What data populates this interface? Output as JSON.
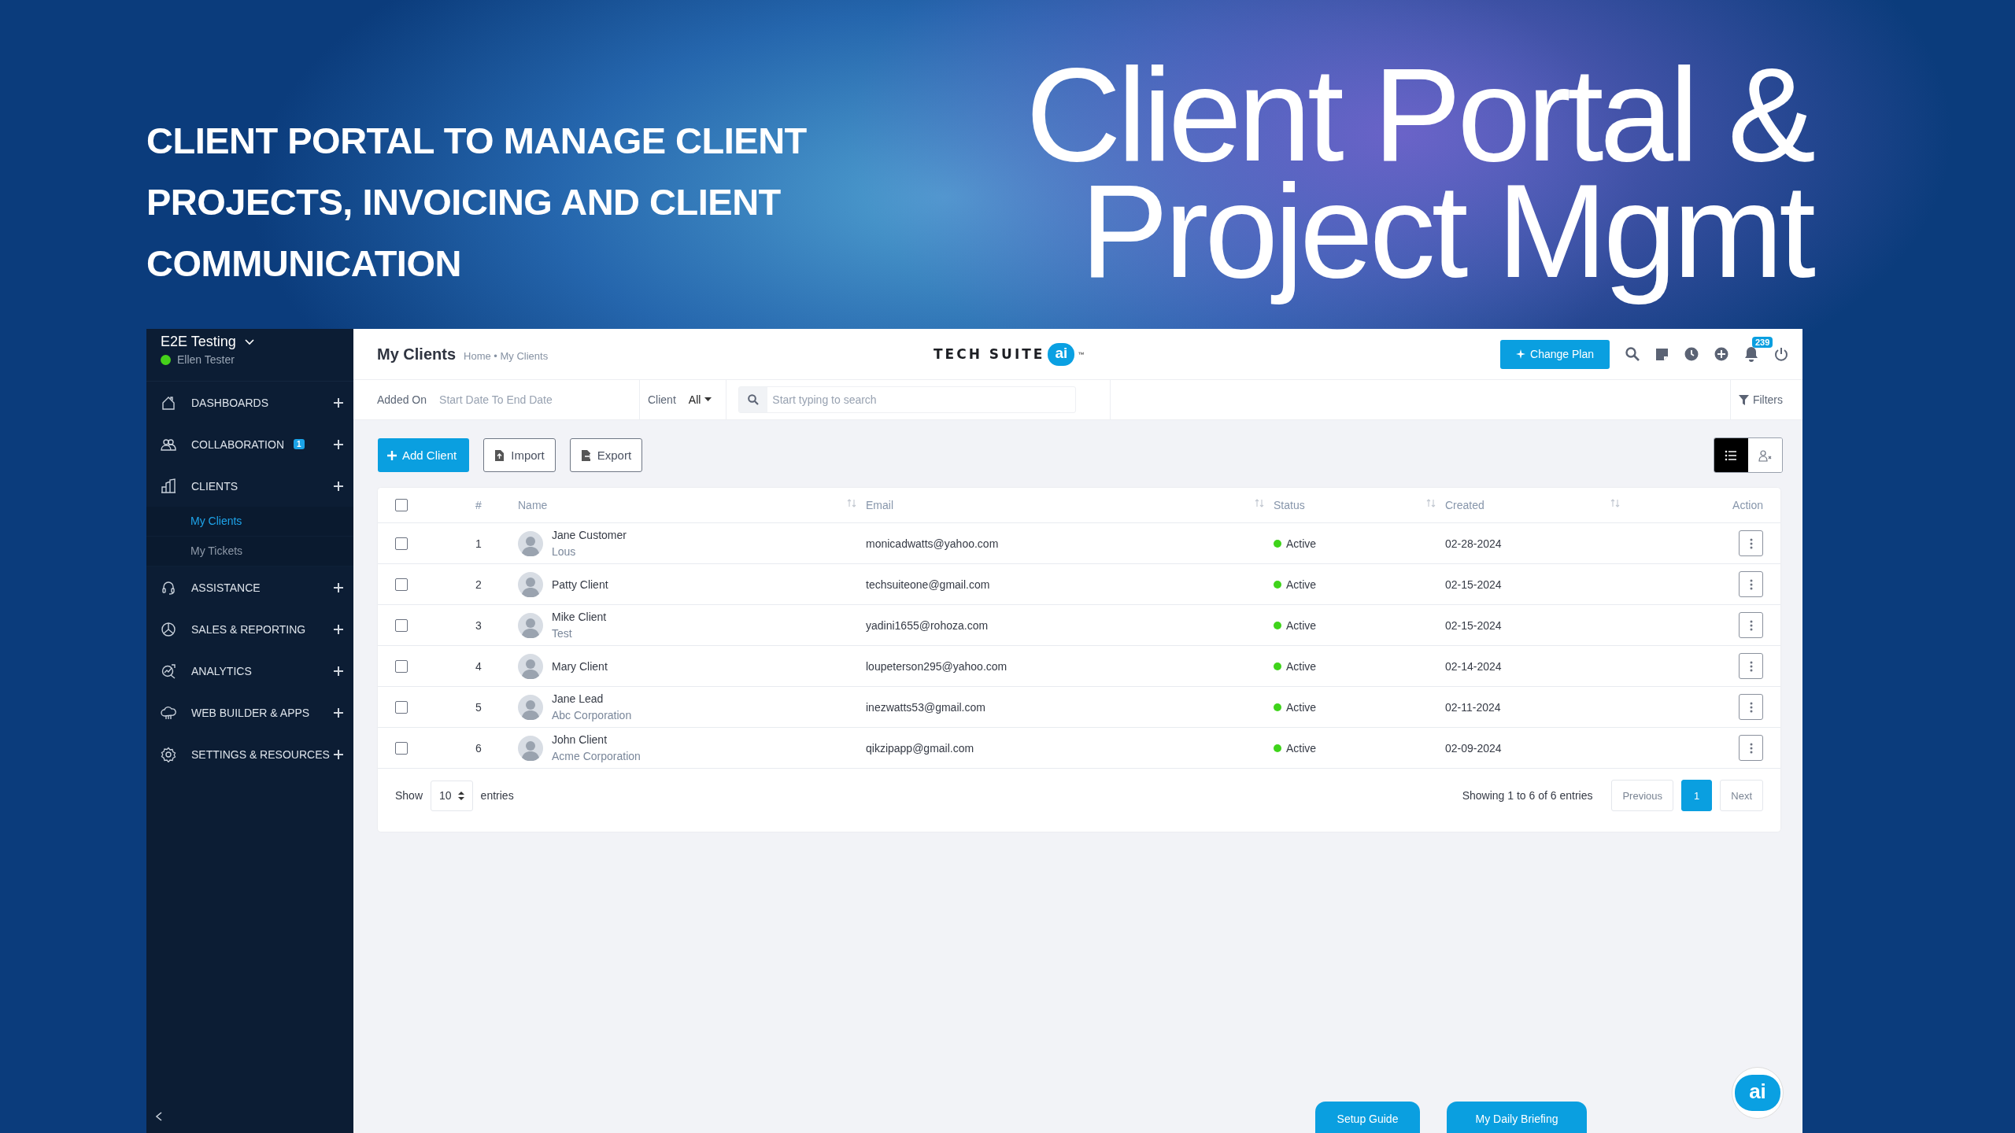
{
  "banner": {
    "subtitle_lines": [
      "CLIENT PORTAL TO MANAGE CLIENT",
      "PROJECTS, INVOICING AND CLIENT",
      "COMMUNICATION"
    ],
    "title_lines": [
      "Client Portal &",
      "Project Mgmt"
    ]
  },
  "sidebar": {
    "workspace": "E2E Testing",
    "user": "Ellen Tester",
    "user_online": true,
    "items": [
      {
        "label": "DASHBOARDS"
      },
      {
        "label": "COLLABORATION",
        "badge": "1"
      },
      {
        "label": "CLIENTS",
        "children": [
          {
            "label": "My Clients",
            "selected": true
          },
          {
            "label": "My Tickets",
            "selected": false
          }
        ]
      },
      {
        "label": "ASSISTANCE"
      },
      {
        "label": "SALES & REPORTING"
      },
      {
        "label": "ANALYTICS"
      },
      {
        "label": "WEB BUILDER & APPS"
      },
      {
        "label": "SETTINGS & RESOURCES"
      }
    ]
  },
  "header": {
    "title": "My Clients",
    "breadcrumb": "Home • My Clients",
    "logo": {
      "text": "TECH SUITE",
      "badge": "ai",
      "trademark": "™"
    },
    "change_plan": "Change Plan",
    "notification_count": "239"
  },
  "filters": {
    "added_on_label": "Added On",
    "date_placeholder": "Start Date To End Date",
    "client_label": "Client",
    "client_value": "All",
    "search_placeholder": "Start typing to search",
    "filters_button": "Filters"
  },
  "toolbar": {
    "buttons": [
      "Add Client",
      "Import",
      "Export"
    ],
    "views": [
      {
        "selected": true
      },
      {
        "selected": false
      }
    ]
  },
  "table": {
    "header_checked": false,
    "columns": [
      {
        "label": "#",
        "sortable": false
      },
      {
        "label": "Name",
        "sortable": true
      },
      {
        "label": "Email",
        "sortable": true
      },
      {
        "label": "Status",
        "sortable": true
      },
      {
        "label": "Created",
        "sortable": true
      },
      {
        "label": "Action",
        "sortable": false
      }
    ],
    "rows": [
      {
        "checked": false,
        "number": "1",
        "name": "Jane Customer",
        "subtitle": "Lous",
        "email": "monicadwatts@yahoo.com",
        "status": "Active",
        "color": "#3fd41b",
        "created": "02-28-2024"
      },
      {
        "checked": false,
        "number": "2",
        "name": "Patty Client",
        "email": "techsuiteone@gmail.com",
        "status": "Active",
        "color": "#3fd41b",
        "created": "02-15-2024"
      },
      {
        "checked": false,
        "number": "3",
        "name": "Mike Client",
        "subtitle": "Test",
        "email": "yadini1655@rohoza.com",
        "status": "Active",
        "color": "#3fd41b",
        "created": "02-15-2024"
      },
      {
        "checked": false,
        "number": "4",
        "name": "Mary Client",
        "email": "loupeterson295@yahoo.com",
        "status": "Active",
        "color": "#3fd41b",
        "created": "02-14-2024"
      },
      {
        "checked": false,
        "number": "5",
        "name": "Jane Lead",
        "subtitle": "Abc Corporation",
        "email": "inezwatts53@gmail.com",
        "status": "Active",
        "color": "#3fd41b",
        "created": "02-11-2024"
      },
      {
        "checked": false,
        "number": "6",
        "name": "John Client",
        "subtitle": "Acme Corporation",
        "email": "qikzipapp@gmail.com",
        "status": "Active",
        "color": "#3fd41b",
        "created": "02-09-2024"
      }
    ],
    "footer": {
      "show": "Show",
      "page_size": "10",
      "entries": "entries",
      "summary": "Showing 1 to 6 of 6 entries",
      "previous": "Previous",
      "next": "Next",
      "pages": [
        {
          "label": "1",
          "selected": true
        }
      ]
    }
  },
  "bottom_buttons": [
    "Setup Guide",
    "My Daily Briefing"
  ],
  "assistant_button": {
    "label": "ai"
  }
}
